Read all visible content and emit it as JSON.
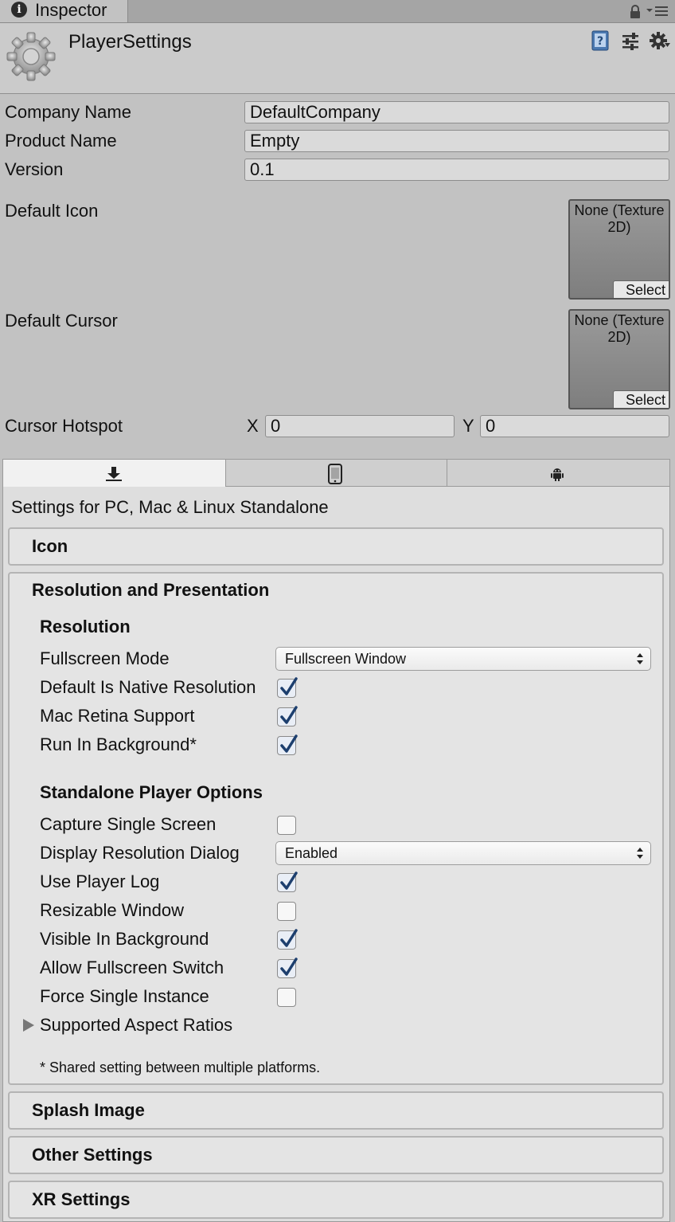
{
  "window": {
    "tab_label": "Inspector"
  },
  "header": {
    "title": "PlayerSettings"
  },
  "fields": {
    "company_name_label": "Company Name",
    "company_name_value": "DefaultCompany",
    "product_name_label": "Product Name",
    "product_name_value": "Empty",
    "version_label": "Version",
    "version_value": "0.1",
    "default_icon_label": "Default Icon",
    "default_cursor_label": "Default Cursor",
    "texture_none_line1": "None (Texture",
    "texture_none_line2": "2D)",
    "select_label": "Select",
    "cursor_hotspot_label": "Cursor Hotspot",
    "hotspot_x_label": "X",
    "hotspot_x_value": "0",
    "hotspot_y_label": "Y",
    "hotspot_y_value": "0"
  },
  "platform": {
    "tabs": [
      "standalone-icon",
      "mobile-icon",
      "android-icon"
    ],
    "active_tab": 0,
    "settings_for": "Settings for PC, Mac & Linux Standalone"
  },
  "sections": {
    "icon": "Icon",
    "resolution_presentation": "Resolution and Presentation",
    "splash_image": "Splash Image",
    "other_settings": "Other Settings",
    "xr_settings": "XR Settings"
  },
  "resolution": {
    "header": "Resolution",
    "fullscreen_mode_label": "Fullscreen Mode",
    "fullscreen_mode_value": "Fullscreen Window",
    "default_native_label": "Default Is Native Resolution",
    "default_native_checked": true,
    "mac_retina_label": "Mac Retina Support",
    "mac_retina_checked": true,
    "run_in_background_label": "Run In Background*",
    "run_in_background_checked": true
  },
  "standalone": {
    "header": "Standalone Player Options",
    "capture_single_label": "Capture Single Screen",
    "capture_single_checked": false,
    "display_dialog_label": "Display Resolution Dialog",
    "display_dialog_value": "Enabled",
    "use_player_log_label": "Use Player Log",
    "use_player_log_checked": true,
    "resizable_label": "Resizable Window",
    "resizable_checked": false,
    "visible_bg_label": "Visible In Background",
    "visible_bg_checked": true,
    "allow_fullscreen_label": "Allow Fullscreen Switch",
    "allow_fullscreen_checked": true,
    "force_single_label": "Force Single Instance",
    "force_single_checked": false,
    "aspect_ratios_label": "Supported Aspect Ratios",
    "shared_note": "* Shared setting between multiple platforms."
  },
  "colors": {
    "window_bg": "#c2c2c2",
    "panel_bg": "#dedede",
    "check_color": "#1d3f6e"
  }
}
